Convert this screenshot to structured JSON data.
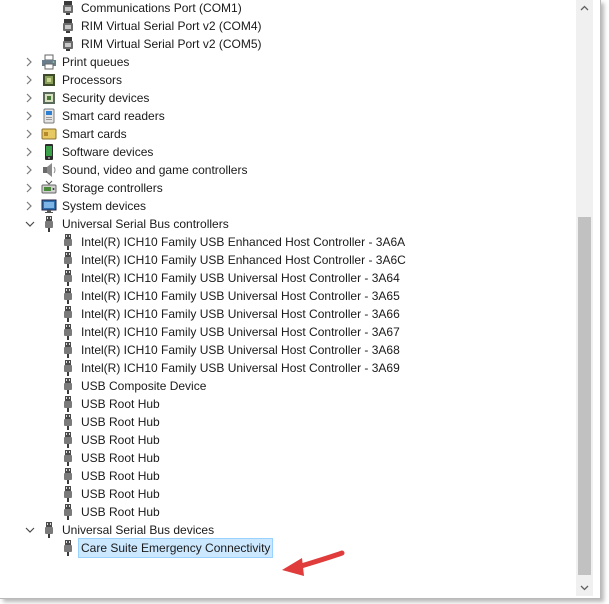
{
  "tree": {
    "rows": [
      {
        "label": "Communications Port (COM1)",
        "level": 1,
        "expander": "none",
        "icon": "port-icon"
      },
      {
        "label": "RIM Virtual Serial Port v2 (COM4)",
        "level": 1,
        "expander": "none",
        "icon": "port-icon"
      },
      {
        "label": "RIM Virtual Serial Port v2 (COM5)",
        "level": 1,
        "expander": "none",
        "icon": "port-icon"
      },
      {
        "label": "Print queues",
        "level": 0,
        "expander": "collapsed",
        "icon": "printer-icon"
      },
      {
        "label": "Processors",
        "level": 0,
        "expander": "collapsed",
        "icon": "processor-icon"
      },
      {
        "label": "Security devices",
        "level": 0,
        "expander": "collapsed",
        "icon": "security-device-icon"
      },
      {
        "label": "Smart card readers",
        "level": 0,
        "expander": "collapsed",
        "icon": "smart-card-reader-icon"
      },
      {
        "label": "Smart cards",
        "level": 0,
        "expander": "collapsed",
        "icon": "smart-card-icon"
      },
      {
        "label": "Software devices",
        "level": 0,
        "expander": "collapsed",
        "icon": "software-device-icon"
      },
      {
        "label": "Sound, video and game controllers",
        "level": 0,
        "expander": "collapsed",
        "icon": "speaker-icon"
      },
      {
        "label": "Storage controllers",
        "level": 0,
        "expander": "collapsed",
        "icon": "storage-controller-icon"
      },
      {
        "label": "System devices",
        "level": 0,
        "expander": "collapsed",
        "icon": "system-device-icon"
      },
      {
        "label": "Universal Serial Bus controllers",
        "level": 0,
        "expander": "expanded",
        "icon": "usb-plug-icon"
      },
      {
        "label": "Intel(R) ICH10 Family USB Enhanced Host Controller - 3A6A",
        "level": 1,
        "expander": "none",
        "icon": "usb-plug-icon"
      },
      {
        "label": "Intel(R) ICH10 Family USB Enhanced Host Controller - 3A6C",
        "level": 1,
        "expander": "none",
        "icon": "usb-plug-icon"
      },
      {
        "label": "Intel(R) ICH10 Family USB Universal Host Controller - 3A64",
        "level": 1,
        "expander": "none",
        "icon": "usb-plug-icon"
      },
      {
        "label": "Intel(R) ICH10 Family USB Universal Host Controller - 3A65",
        "level": 1,
        "expander": "none",
        "icon": "usb-plug-icon"
      },
      {
        "label": "Intel(R) ICH10 Family USB Universal Host Controller - 3A66",
        "level": 1,
        "expander": "none",
        "icon": "usb-plug-icon"
      },
      {
        "label": "Intel(R) ICH10 Family USB Universal Host Controller - 3A67",
        "level": 1,
        "expander": "none",
        "icon": "usb-plug-icon"
      },
      {
        "label": "Intel(R) ICH10 Family USB Universal Host Controller - 3A68",
        "level": 1,
        "expander": "none",
        "icon": "usb-plug-icon"
      },
      {
        "label": "Intel(R) ICH10 Family USB Universal Host Controller - 3A69",
        "level": 1,
        "expander": "none",
        "icon": "usb-plug-icon"
      },
      {
        "label": "USB Composite Device",
        "level": 1,
        "expander": "none",
        "icon": "usb-plug-icon"
      },
      {
        "label": "USB Root Hub",
        "level": 1,
        "expander": "none",
        "icon": "usb-plug-icon"
      },
      {
        "label": "USB Root Hub",
        "level": 1,
        "expander": "none",
        "icon": "usb-plug-icon"
      },
      {
        "label": "USB Root Hub",
        "level": 1,
        "expander": "none",
        "icon": "usb-plug-icon"
      },
      {
        "label": "USB Root Hub",
        "level": 1,
        "expander": "none",
        "icon": "usb-plug-icon"
      },
      {
        "label": "USB Root Hub",
        "level": 1,
        "expander": "none",
        "icon": "usb-plug-icon"
      },
      {
        "label": "USB Root Hub",
        "level": 1,
        "expander": "none",
        "icon": "usb-plug-icon"
      },
      {
        "label": "USB Root Hub",
        "level": 1,
        "expander": "none",
        "icon": "usb-plug-icon"
      },
      {
        "label": "Universal Serial Bus devices",
        "level": 0,
        "expander": "expanded",
        "icon": "usb-plug-icon"
      },
      {
        "label": "Care Suite Emergency Connectivity",
        "level": 1,
        "expander": "none",
        "icon": "usb-plug-icon",
        "selected": true
      }
    ]
  },
  "annotation": {
    "arrow_color": "#e03c3c",
    "points_to": "Care Suite Emergency Connectivity"
  },
  "colors": {
    "selection_background": "#cce8ff",
    "selection_border": "#99d1ff",
    "scrollbar_thumb": "#c1c1c1"
  }
}
